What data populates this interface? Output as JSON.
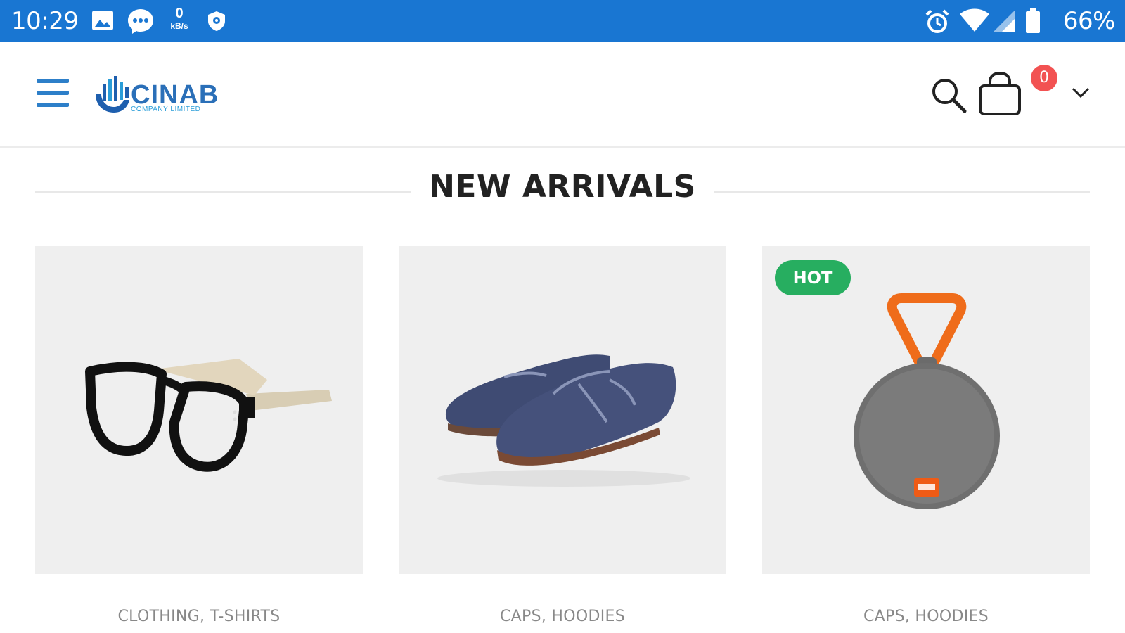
{
  "status_bar": {
    "time": "10:29",
    "speed_value": "0",
    "speed_unit": "kB/s",
    "battery": "66%",
    "icons": [
      "image-icon",
      "messenger-icon",
      "network-speed-icon",
      "shield-icon",
      "alarm-icon",
      "wifi-icon",
      "signal-icon",
      "battery-icon"
    ]
  },
  "header": {
    "logo_text": "CINAB",
    "logo_subtext": "COMPANY LIMITED",
    "cart_count": "0",
    "icons": [
      "menu-icon",
      "search-icon",
      "shopping-bag-icon",
      "chevron-down-icon"
    ]
  },
  "section": {
    "title": "NEW ARRIVALS"
  },
  "products": [
    {
      "category": "CLOTHING, T-SHIRTS",
      "image": "eyeglasses",
      "badge": ""
    },
    {
      "category": "CAPS, HOODIES",
      "image": "loafer-shoes",
      "badge": ""
    },
    {
      "category": "CAPS, HOODIES",
      "image": "bluetooth-speaker",
      "badge": "HOT"
    }
  ],
  "colors": {
    "status_bar": "#1976d2",
    "menu_accent": "#2d7fc9",
    "cart_badge": "#f25252",
    "hot_badge": "#27ae60"
  }
}
